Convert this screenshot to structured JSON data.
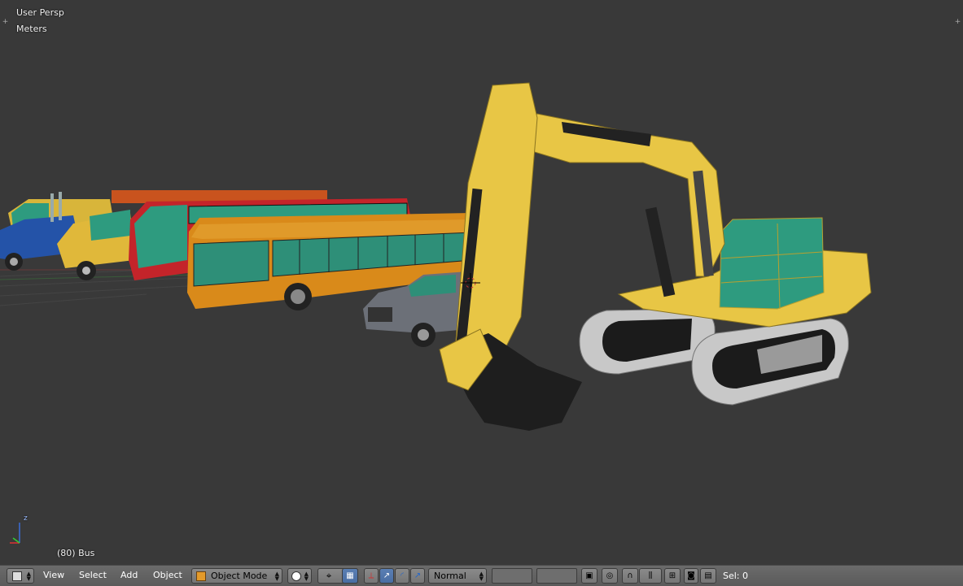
{
  "viewport": {
    "view_label": "User Persp",
    "units_label": "Meters",
    "object_label": "(80) Bus"
  },
  "axes": {
    "z_label": "z"
  },
  "header": {
    "editor_type_icon": "cube-icon",
    "menus": {
      "view": "View",
      "select": "Select",
      "add": "Add",
      "object": "Object"
    },
    "mode": {
      "label": "Object Mode",
      "icon": "orange-cube-icon"
    },
    "viewport_shading_icon": "sphere-icon",
    "pivot_icon": "pivot-crosshair-icon",
    "transform_orientation": "Normal",
    "selection_status": "Sel: 0"
  },
  "colors": {
    "background": "#393939",
    "header_bg": "#5e5e5e",
    "excavator_yellow": "#e8c645",
    "cab_teal": "#2e9b7f",
    "bus_orange": "#d98a1a",
    "bus_red": "#c4242a",
    "truck_blue": "#2453a8",
    "pickup_gray": "#6c7078",
    "active_blue": "#5680c2"
  }
}
